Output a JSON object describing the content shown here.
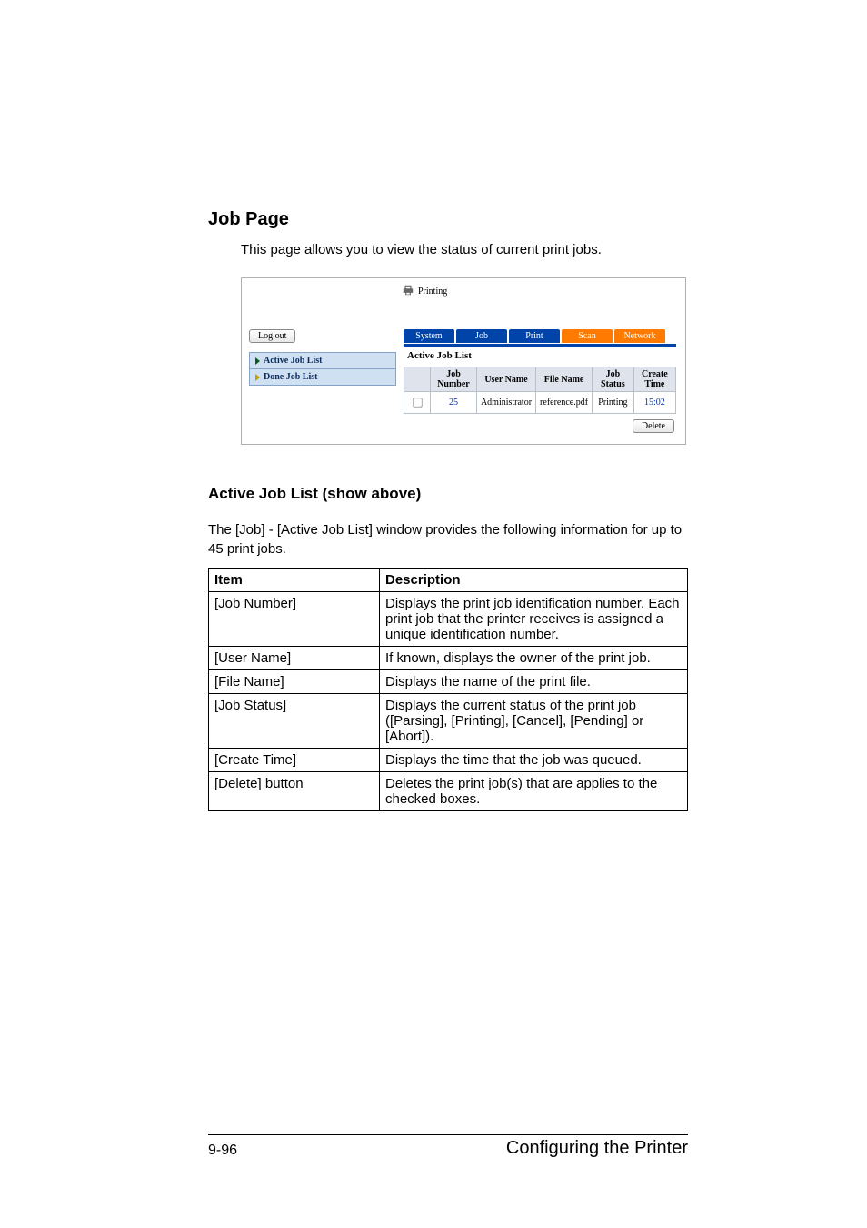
{
  "headings": {
    "section": "Job Page",
    "intro": "This page allows you to view the status of current print jobs.",
    "sub": "Active Job List (show above)",
    "lead": "The [Job] - [Active Job List] window provides the following information for up to 45 print jobs."
  },
  "shot": {
    "printing_label": "Printing",
    "logout": "Log out",
    "side": {
      "active": "Active Job List",
      "done": "Done Job List"
    },
    "tabs": {
      "system": "System",
      "job": "Job",
      "print": "Print",
      "scan": "Scan",
      "network": "Network"
    },
    "panel_title": "Active Job List",
    "columns": {
      "chk": "",
      "job_number": "Job Number",
      "user_name": "User Name",
      "file_name": "File Name",
      "job_status": "Job Status",
      "create_time": "Create Time"
    },
    "row": {
      "job_number": "25",
      "user_name": "Administrator",
      "file_name": "reference.pdf",
      "job_status": "Printing",
      "create_time": "15:02"
    },
    "delete": "Delete"
  },
  "table": {
    "h_item": "Item",
    "h_desc": "Description",
    "rows": [
      {
        "item": "[Job Number]",
        "desc": "Displays the print job identification number. Each print job that the printer receives is assigned a unique identification number."
      },
      {
        "item": "[User Name]",
        "desc": "If known, displays the owner of the print job."
      },
      {
        "item": "[File Name]",
        "desc": "Displays the name of the print file."
      },
      {
        "item": "[Job Status]",
        "desc": "Displays the current status of the print job ([Parsing], [Printing], [Cancel], [Pending] or [Abort])."
      },
      {
        "item": "[Create Time]",
        "desc": "Displays the time that the job was queued."
      },
      {
        "item": "[Delete] button",
        "desc": "Deletes the print job(s) that are applies to the checked boxes."
      }
    ]
  },
  "footer": {
    "left": "9-96",
    "right": "Configuring the Printer"
  }
}
